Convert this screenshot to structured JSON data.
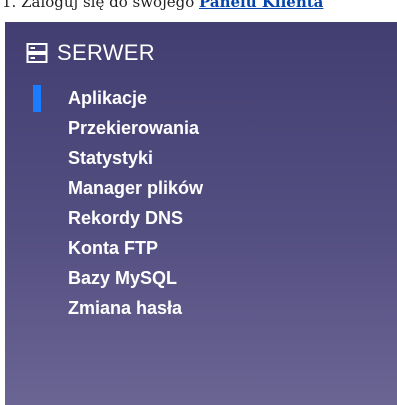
{
  "instruction": {
    "prefix": "1. Zaloguj się do swojego ",
    "link": "Panelu Klienta"
  },
  "sidebar": {
    "section_title": "SERWER",
    "section_icon": "server-icon",
    "active_index": 0,
    "accent_color": "#1a7cff",
    "items": [
      {
        "label": "Aplikacje"
      },
      {
        "label": "Przekierowania"
      },
      {
        "label": "Statystyki"
      },
      {
        "label": "Manager plików"
      },
      {
        "label": "Rekordy DNS"
      },
      {
        "label": "Konta FTP"
      },
      {
        "label": "Bazy MySQL"
      },
      {
        "label": "Zmiana hasła"
      }
    ]
  }
}
